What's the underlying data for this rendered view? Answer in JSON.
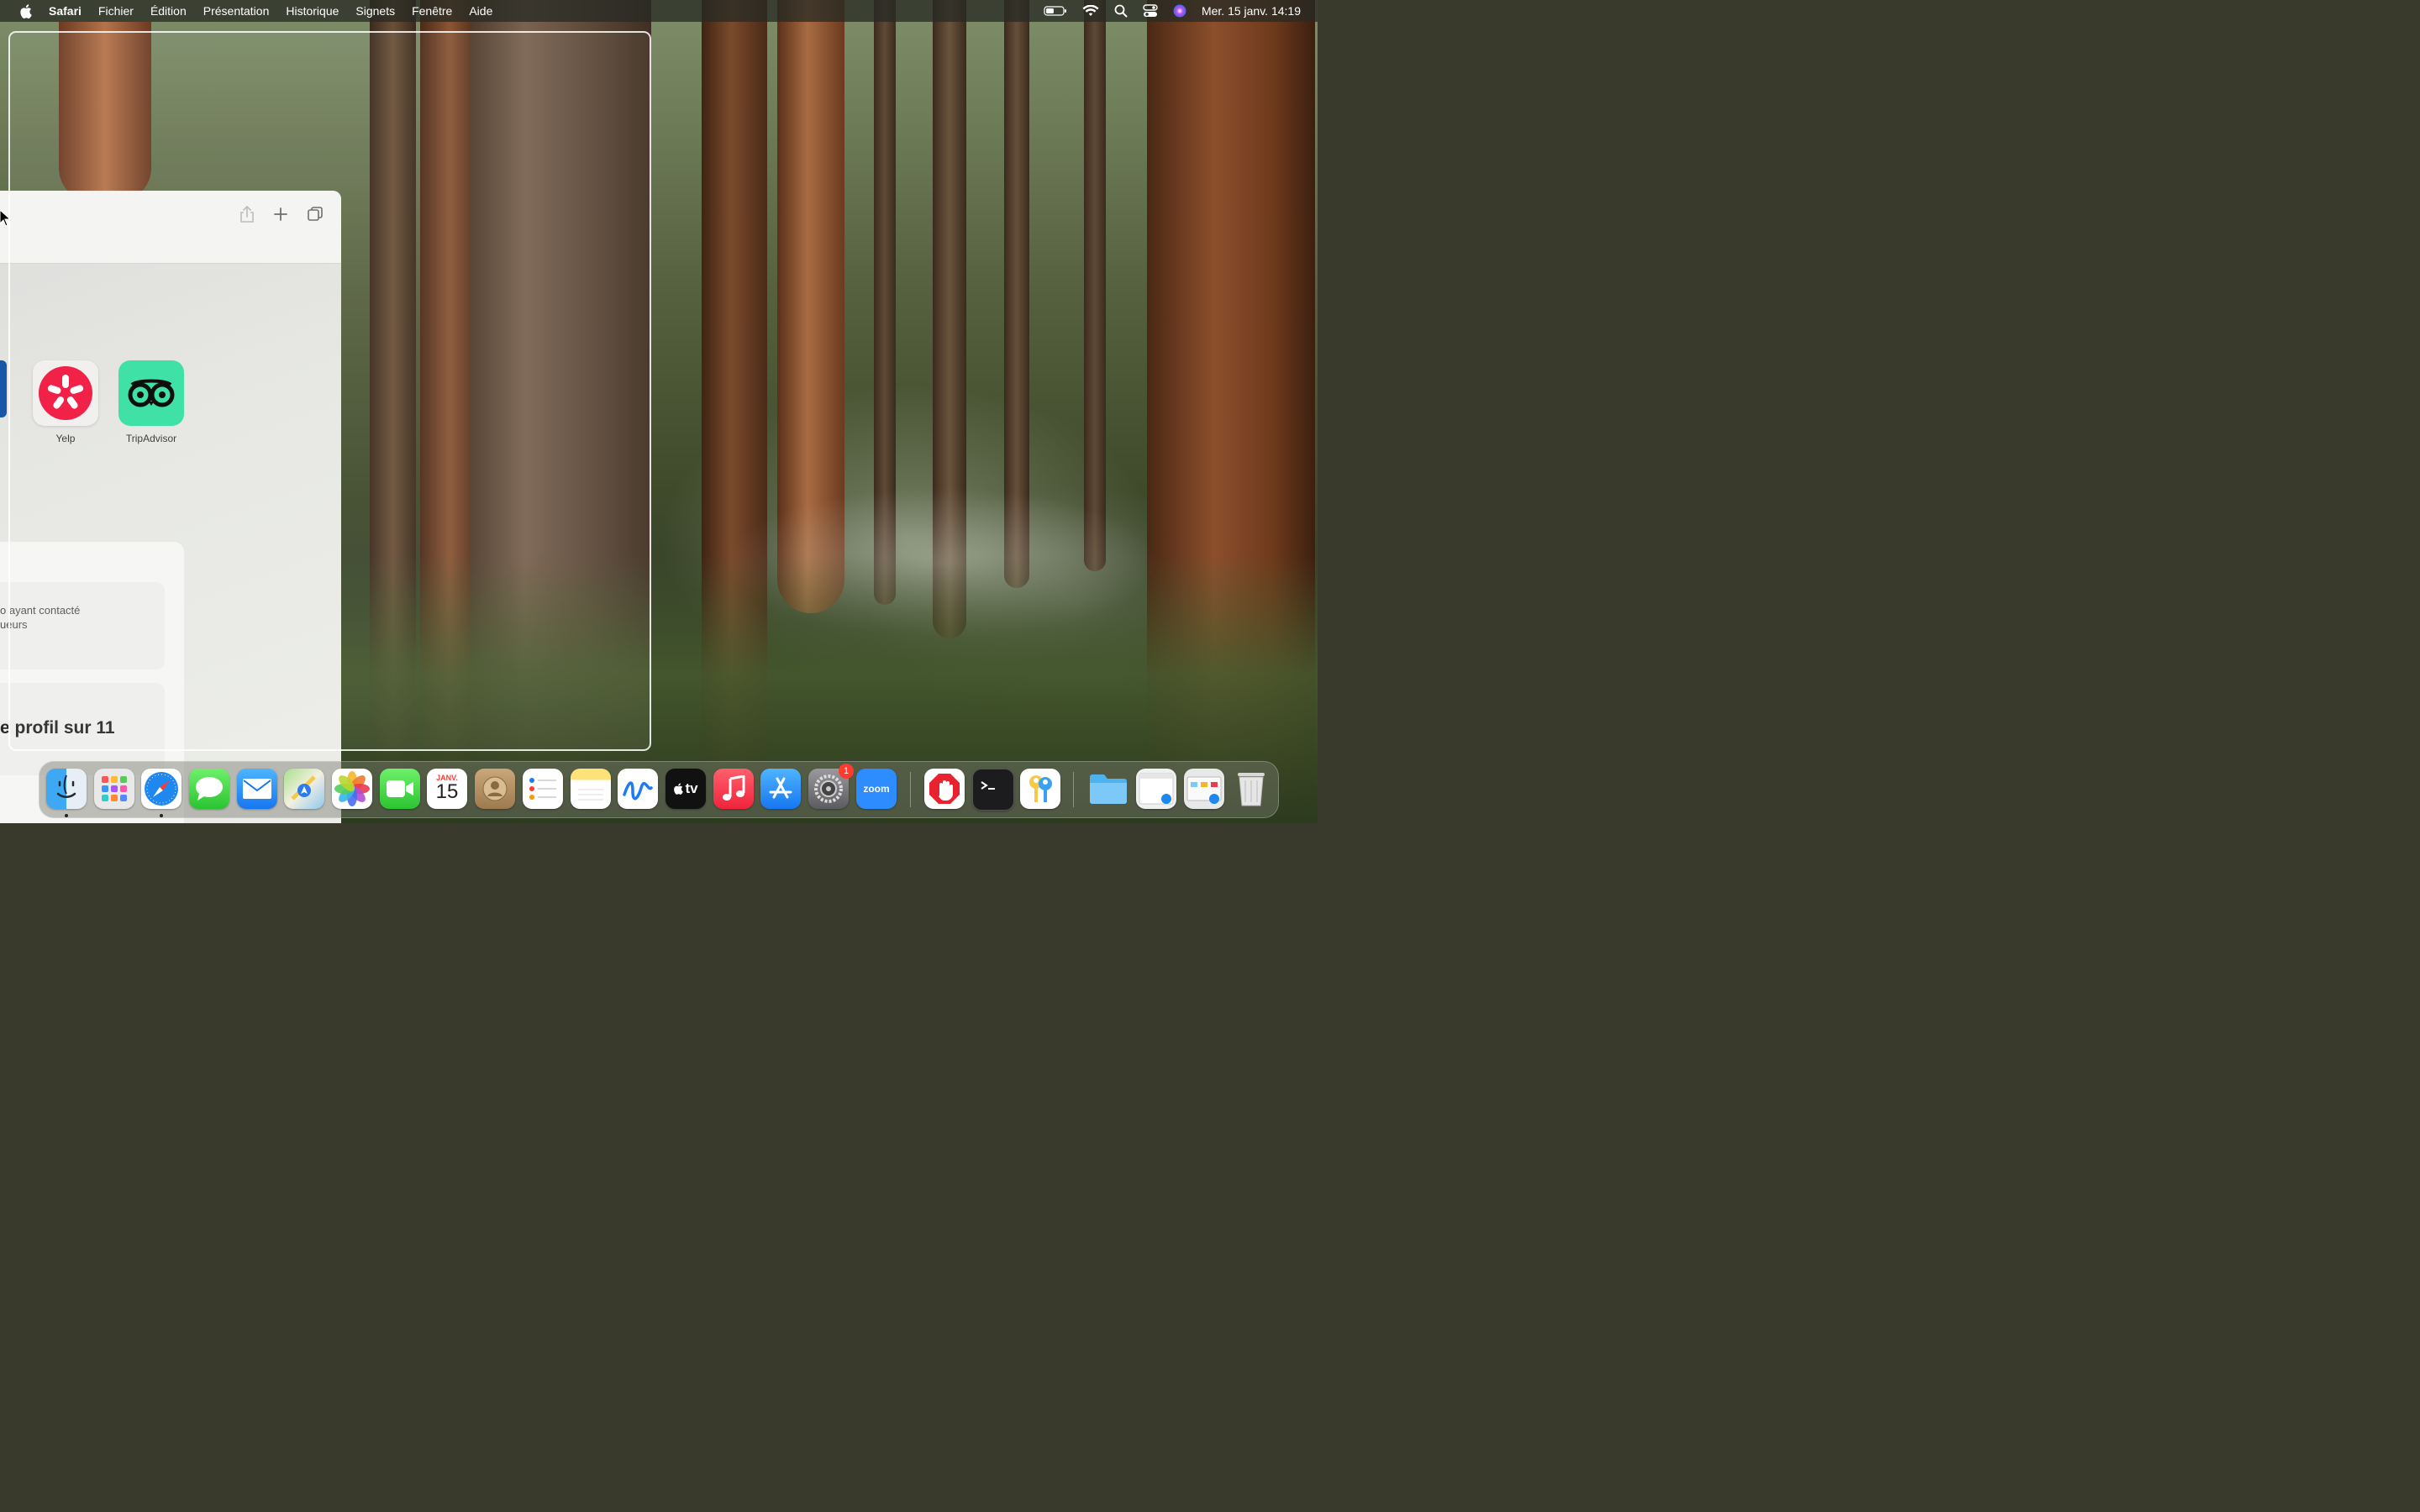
{
  "menubar": {
    "app_name": "Safari",
    "items": [
      "Fichier",
      "Édition",
      "Présentation",
      "Historique",
      "Signets",
      "Fenêtre",
      "Aide"
    ],
    "clock": "Mer. 15 janv.  14:19",
    "status_icons": [
      "battery-icon",
      "wifi-icon",
      "spotlight-icon",
      "control-center-icon",
      "siri-icon"
    ]
  },
  "safari": {
    "favorites": [
      {
        "label": "Yelp",
        "color": "#f2143c"
      },
      {
        "label": "TripAdvisor",
        "color": "#34e0a1"
      }
    ],
    "card": {
      "text": "o ayant contacté\nueurs",
      "title": "e profil sur 11"
    }
  },
  "dock": {
    "calendar_month": "JANV.",
    "calendar_day": "15",
    "apple_tv_label": "tv",
    "zoom_label": "zoom",
    "settings_badge": "1",
    "apps": [
      "Finder",
      "Launchpad",
      "Safari",
      "Messages",
      "Mail",
      "Plans",
      "Photos",
      "FaceTime",
      "Calendrier",
      "Contacts",
      "Rappels",
      "Notes",
      "Freeform",
      "Apple TV",
      "Musique",
      "App Store",
      "Réglages Système",
      "Zoom",
      "Adblock",
      "Terminal",
      "Keychain",
      "Dossier",
      "Fenêtre",
      "Fenêtre 2",
      "Corbeille"
    ]
  }
}
